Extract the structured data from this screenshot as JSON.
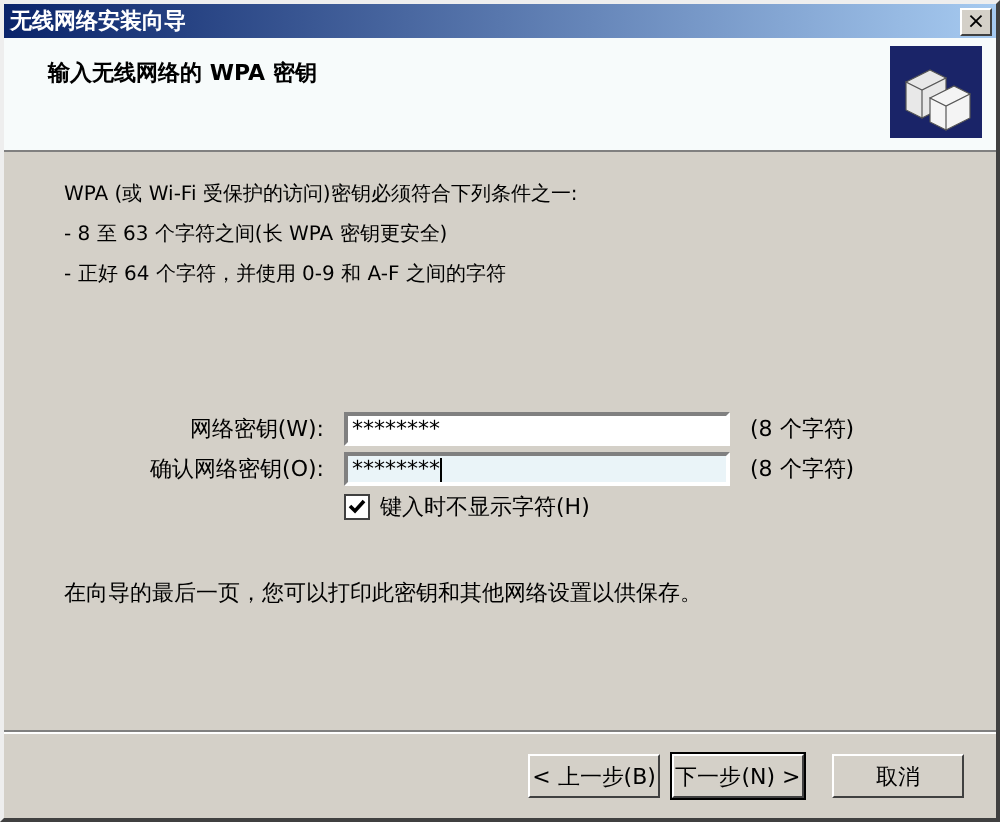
{
  "window": {
    "title": "无线网络安装向导",
    "close": "×"
  },
  "header": {
    "title": "输入无线网络的 WPA 密钥"
  },
  "intro": [
    "WPA (或 Wi-Fi 受保护的访问)密钥必须符合下列条件之一:",
    "- 8 至 63 个字符之间(长 WPA 密钥更安全)",
    "- 正好 64 个字符，并使用 0-9 和 A-F 之间的字符"
  ],
  "fields": [
    {
      "label": "网络密钥(W):",
      "value": "********",
      "count": "(8 个字符)",
      "focused": false
    },
    {
      "label": "确认网络密钥(O):",
      "value": "********",
      "count": "(8 个字符)",
      "focused": true
    }
  ],
  "checkbox": {
    "label": "键入时不显示字符(H)",
    "checked": true
  },
  "note": "在向导的最后一页，您可以打印此密钥和其他网络设置以供保存。",
  "buttons": [
    {
      "label": "< 上一步(B)",
      "default": false
    },
    {
      "label": "下一步(N) >",
      "default": true
    },
    {
      "label": "取消",
      "default": false
    }
  ]
}
